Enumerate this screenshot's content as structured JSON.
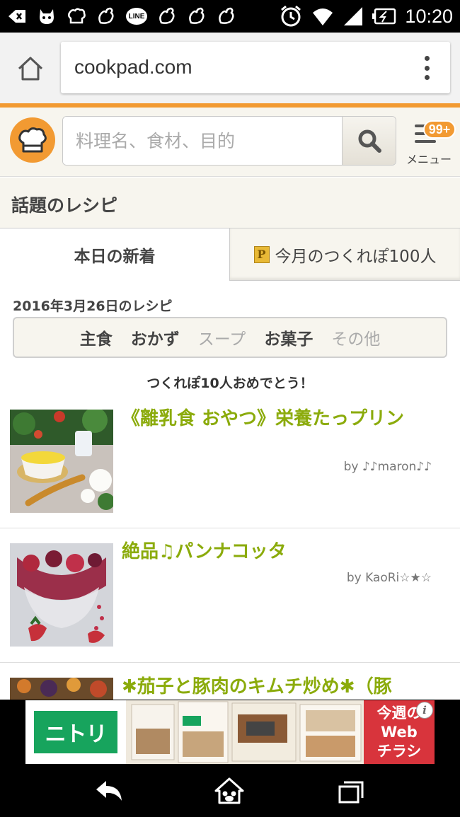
{
  "status_bar": {
    "time": "10:20",
    "line_badge": "LINE",
    "icons": [
      "back-arrow-icon",
      "cat-icon",
      "chef-hat-icon",
      "bird-icon",
      "line-app-icon",
      "bird-icon",
      "bird-icon",
      "bird-icon",
      "alarm-icon",
      "wifi-icon",
      "signal-icon",
      "battery-icon"
    ]
  },
  "browser": {
    "url": "cookpad.com"
  },
  "header": {
    "search_placeholder": "料理名、食材、目的",
    "menu_badge": "99+",
    "menu_label": "メニュー",
    "accent_color": "#f29a32"
  },
  "section": {
    "title": "話題のレシピ"
  },
  "tabs": [
    {
      "label": "本日の新着",
      "active": true
    },
    {
      "label": "今月のつくれぽ100人",
      "active": false,
      "icon_letter": "P"
    }
  ],
  "date_label": "2016年3月26日のレシピ",
  "categories": [
    {
      "label": "主食",
      "enabled": true
    },
    {
      "label": "おかず",
      "enabled": true
    },
    {
      "label": "スープ",
      "enabled": false
    },
    {
      "label": "お菓子",
      "enabled": true
    },
    {
      "label": "その他",
      "enabled": false
    }
  ],
  "congrats": "つくれぽ10人おめでとう！",
  "recipes": [
    {
      "title": "《離乳食 おやつ》栄養たっプリン",
      "author": "by ♪♪maron♪♪"
    },
    {
      "title": "絶品♫パンナコッタ",
      "author": "by KaoRi☆★☆"
    },
    {
      "title": "✱茄子と豚肉のキムチ炒め✱（豚",
      "author": ""
    }
  ],
  "ad": {
    "logo": "ニトリ",
    "headline_1": "今週の",
    "headline_2": "Web",
    "headline_3": "チラシ",
    "info": "i"
  }
}
